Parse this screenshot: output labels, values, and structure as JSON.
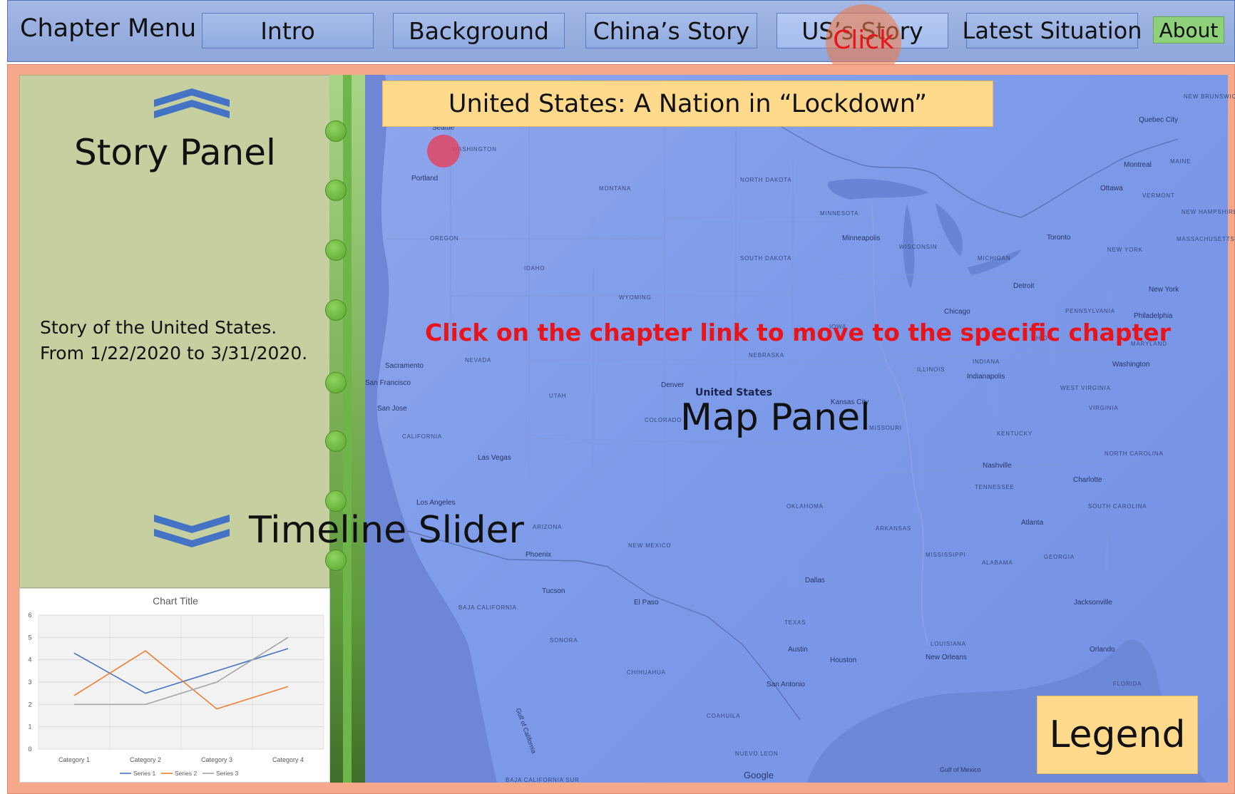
{
  "menu": {
    "title": "Chapter Menu",
    "buttons": [
      "Intro",
      "Background",
      "China’s Story",
      "US’s Story",
      "Latest Situation"
    ],
    "about": "About",
    "click_hint": "Click"
  },
  "story_panel": {
    "title": "Story Panel",
    "text_line1": "Story of the United States.",
    "text_line2": "From 1/22/2020 to 3/31/2020."
  },
  "timeline": {
    "label": "Timeline Slider",
    "dot_count": 8
  },
  "map": {
    "title": "United States: A Nation in “Lockdown”",
    "instruction": "Click on the chapter link to move to the specific chapter",
    "panel_label": "Map Panel",
    "country_label": "United States",
    "legend": "Legend",
    "attribution": "Google",
    "cities": [
      "Seattle",
      "Portland",
      "Sacramento",
      "San Francisco",
      "San Jose",
      "Las Vegas",
      "Los Angeles",
      "Phoenix",
      "Tucson",
      "El Paso",
      "Denver",
      "Kansas City",
      "Minneapolis",
      "Chicago",
      "Detroit",
      "Toronto",
      "Montreal",
      "Ottawa",
      "Quebec City",
      "Indianapolis",
      "Nashville",
      "Charlotte",
      "Atlanta",
      "Dallas",
      "Austin",
      "San Antonio",
      "Houston",
      "New Orleans",
      "Jacksonville",
      "Orlando",
      "New York",
      "Philadelphia",
      "Washington"
    ],
    "states": [
      "WASHINGTON",
      "OREGON",
      "IDAHO",
      "MONTANA",
      "WYOMING",
      "NEVADA",
      "UTAH",
      "CALIFORNIA",
      "ARIZONA",
      "NEW MEXICO",
      "COLORADO",
      "NORTH DAKOTA",
      "SOUTH DAKOTA",
      "NEBRASKA",
      "MINNESOTA",
      "WISCONSIN",
      "MICHIGAN",
      "IOWA",
      "ILLINOIS",
      "MISSOURI",
      "OKLAHOMA",
      "TEXAS",
      "ARKANSAS",
      "LOUISIANA",
      "MISSISSIPPI",
      "ALABAMA",
      "GEORGIA",
      "FLORIDA",
      "TENNESSEE",
      "KENTUCKY",
      "INDIANA",
      "OHIO",
      "WEST VIRGINIA",
      "VIRGINIA",
      "NORTH CAROLINA",
      "SOUTH CAROLINA",
      "PENNSYLVANIA",
      "NEW YORK",
      "MAINE",
      "VERMONT",
      "NEW HAMPSHIRE",
      "MASSACHUSETTS",
      "MARYLAND",
      "SONORA",
      "CHIHUAHUA",
      "COAHUILA",
      "NUEVO LEON",
      "BAJA CALIFORNIA",
      "BAJA CALIFORNIA SUR",
      "NEW BRUNSWICK"
    ],
    "sea_labels": [
      "Gulf of California",
      "Gulf of Mexico"
    ]
  },
  "colors": {
    "series1": "#4472c4",
    "series2": "#ed7d31",
    "series3": "#a5a5a5",
    "instruction": "#e8141c"
  },
  "chart_data": {
    "type": "line",
    "title": "Chart Title",
    "categories": [
      "Category 1",
      "Category 2",
      "Category 3",
      "Category 4"
    ],
    "series": [
      {
        "name": "Series 1",
        "values": [
          4.3,
          2.5,
          3.5,
          4.5
        ]
      },
      {
        "name": "Series 2",
        "values": [
          2.4,
          4.4,
          1.8,
          2.8
        ]
      },
      {
        "name": "Series 3",
        "values": [
          2,
          2,
          3,
          5
        ]
      }
    ],
    "ylim": [
      0,
      6
    ],
    "yticks": [
      0,
      1,
      2,
      3,
      4,
      5,
      6
    ],
    "grid": true,
    "legend": "bottom"
  }
}
